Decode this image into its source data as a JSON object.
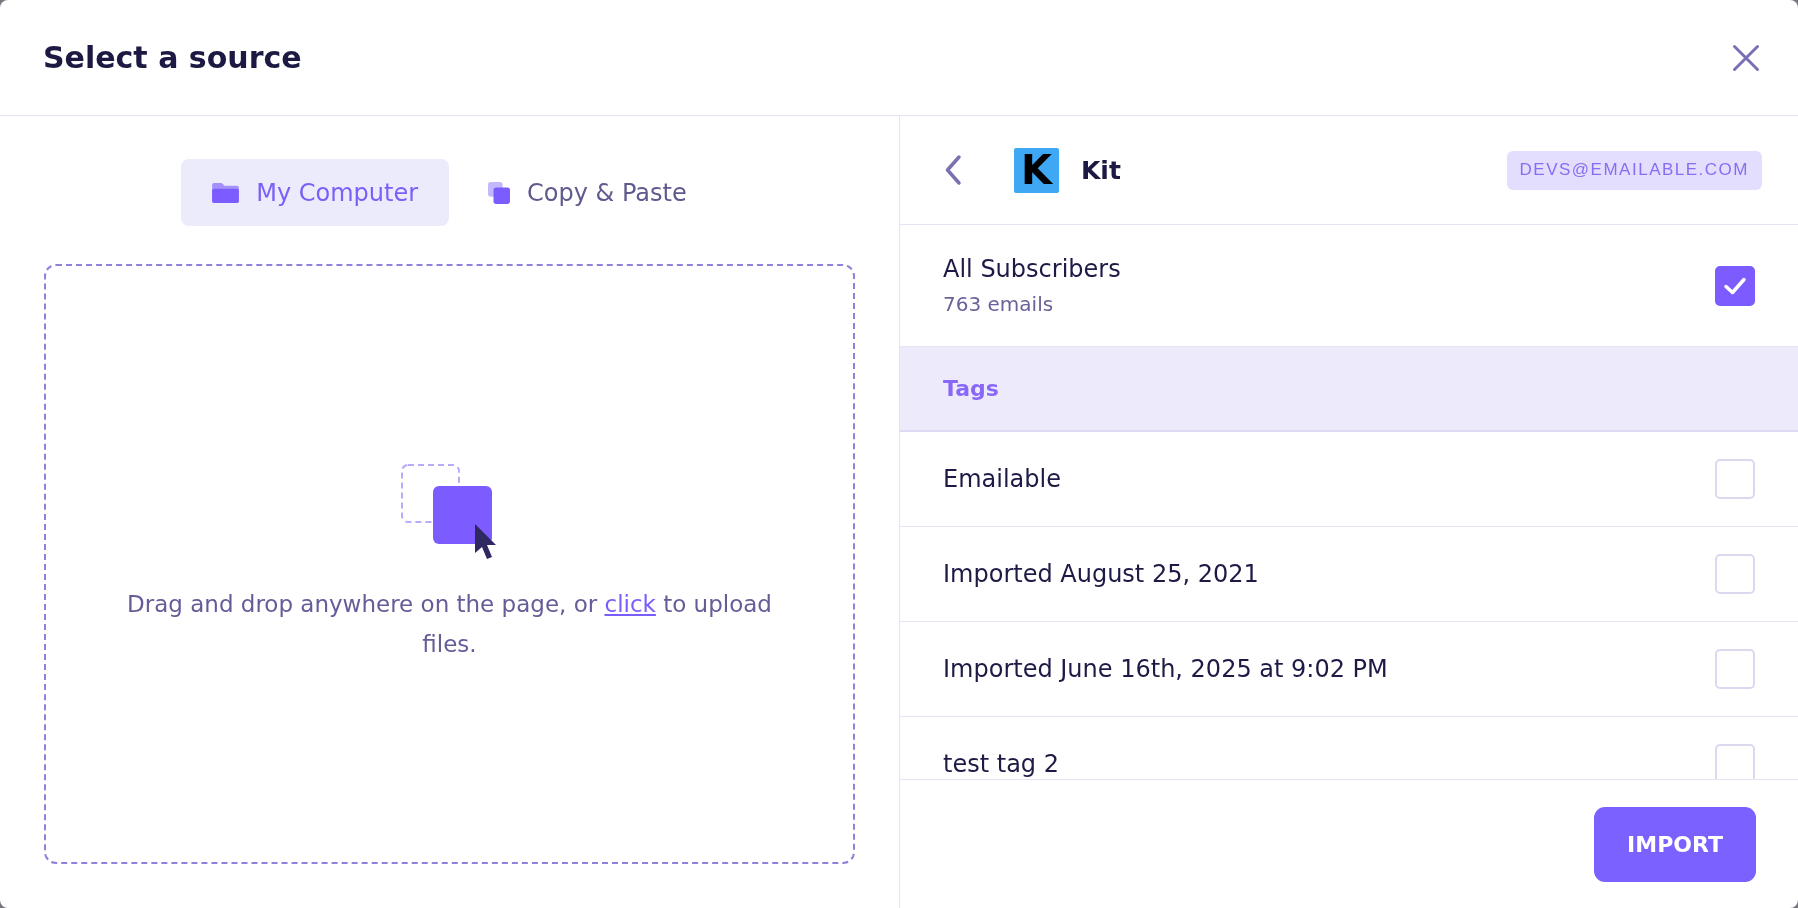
{
  "dialog": {
    "title": "Select a source"
  },
  "source_tabs": [
    {
      "label": "My Computer",
      "kind": "folder",
      "selected": true
    },
    {
      "label": "Copy & Paste",
      "kind": "copy",
      "selected": false
    }
  ],
  "drop_zone": {
    "text_before": "Drag and drop anywhere on the page, or ",
    "link": "click",
    "text_after": " to upload files."
  },
  "integration": {
    "logo_letter": "K",
    "name": "Kit",
    "account": "DEVS@EMAILABLE.COM"
  },
  "all_subscribers": {
    "label": "All Subscribers",
    "count": "763 emails",
    "checked": true
  },
  "tags_section": {
    "title": "Tags",
    "items": [
      {
        "label": "Emailable",
        "checked": false
      },
      {
        "label": "Imported August 25, 2021",
        "checked": false
      },
      {
        "label": "Imported June 16th, 2025 at 9:02 PM",
        "checked": false
      },
      {
        "label": "test tag 2",
        "checked": false
      }
    ]
  },
  "import_button": {
    "label": "IMPORT"
  }
}
